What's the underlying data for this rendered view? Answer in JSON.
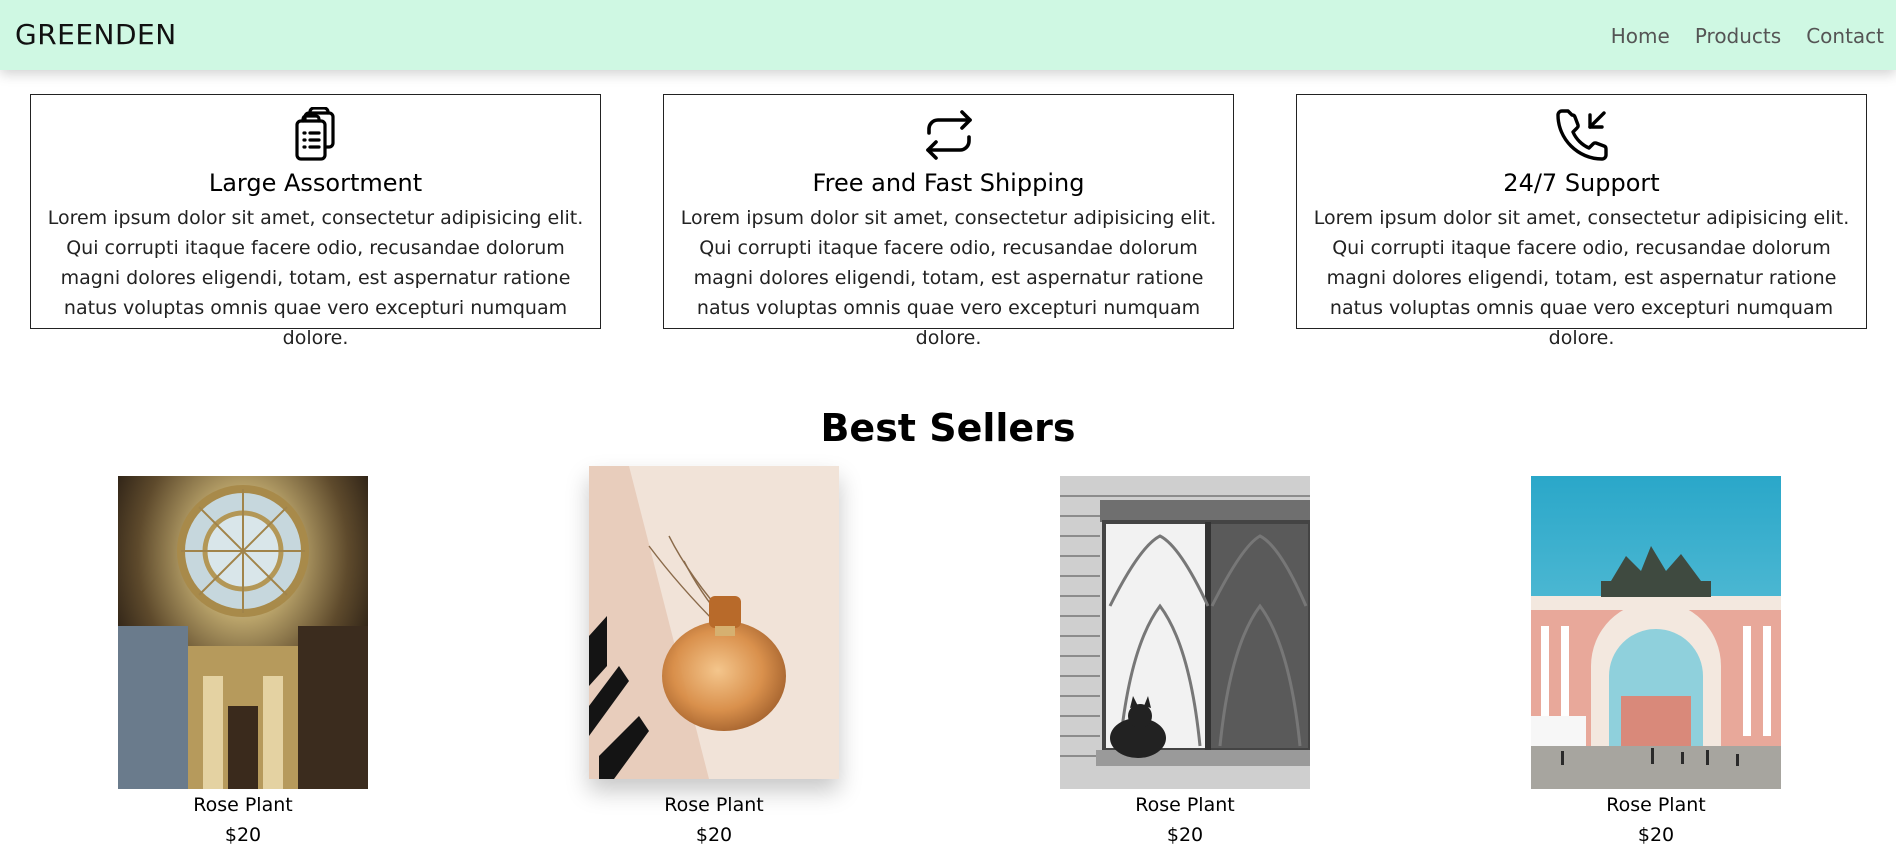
{
  "navbar": {
    "brand": "GREENDEN",
    "links": [
      "Home",
      "Products",
      "Contact"
    ]
  },
  "features": [
    {
      "icon": "clipboard-icon",
      "title": "Large Assortment",
      "text": "Lorem ipsum dolor sit amet, consectetur adipisicing elit. Qui corrupti itaque facere odio, recusandae dolorum magni dolores eligendi, totam, est aspernatur ratione natus voluptas omnis quae vero excepturi numquam dolore."
    },
    {
      "icon": "refresh-arrows-icon",
      "title": "Free and Fast Shipping",
      "text": "Lorem ipsum dolor sit amet, consectetur adipisicing elit. Qui corrupti itaque facere odio, recusandae dolorum magni dolores eligendi, totam, est aspernatur ratione natus voluptas omnis quae vero excepturi numquam dolore."
    },
    {
      "icon": "phone-incoming-icon",
      "title": "24/7 Support",
      "text": "Lorem ipsum dolor sit amet, consectetur adipisicing elit. Qui corrupti itaque facere odio, recusandae dolorum magni dolores eligendi, totam, est aspernatur ratione natus voluptas omnis quae vero excepturi numquam dolore."
    }
  ],
  "best_sellers": {
    "title": "Best Sellers",
    "products": [
      {
        "name": "Rose Plant",
        "price": "$20",
        "image": "cathedral-dome-photo"
      },
      {
        "name": "Rose Plant",
        "price": "$20",
        "image": "perfume-bottle-photo"
      },
      {
        "name": "Rose Plant",
        "price": "$20",
        "image": "cat-in-window-photo"
      },
      {
        "name": "Rose Plant",
        "price": "$20",
        "image": "triumphal-arch-photo"
      }
    ]
  },
  "colors": {
    "navbar_bg": "#cff8e3",
    "nav_link": "#555555",
    "text": "#000000",
    "border": "#222222"
  }
}
